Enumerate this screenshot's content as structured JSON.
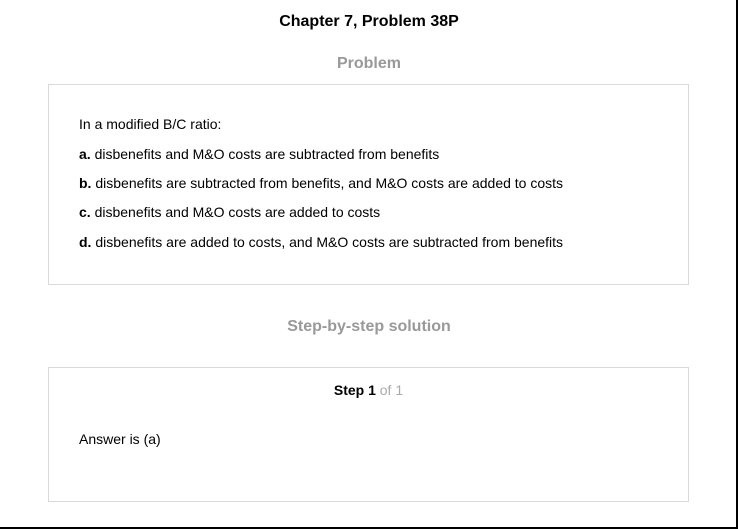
{
  "header": {
    "title": "Chapter 7, Problem 38P"
  },
  "problem": {
    "section_title": "Problem",
    "intro": "In a modified B/C ratio:",
    "options": [
      {
        "letter": "a.",
        "text": "disbenefits and M&O costs are subtracted from benefits"
      },
      {
        "letter": "b.",
        "text": "disbenefits are subtracted from benefits, and M&O costs are added to costs"
      },
      {
        "letter": "c.",
        "text": "disbenefits and M&O costs are added to costs"
      },
      {
        "letter": "d.",
        "text": "disbenefits are added to costs, and M&O costs are subtracted from benefits"
      }
    ]
  },
  "solution": {
    "section_title": "Step-by-step solution",
    "step_label": "Step 1",
    "step_of": "of 1",
    "answer": "Answer is (a)"
  }
}
